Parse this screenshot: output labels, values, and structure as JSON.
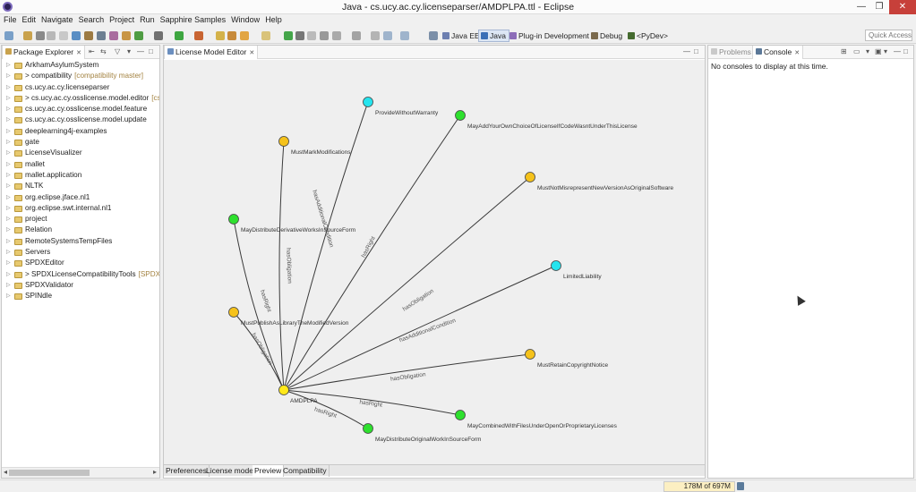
{
  "window": {
    "title": "Java - cs.ucy.ac.cy.licenseparser/AMDPLPA.ttl - Eclipse",
    "minimize": "—",
    "maximize": "❐",
    "close": "✕"
  },
  "menu": [
    "File",
    "Edit",
    "Navigate",
    "Search",
    "Project",
    "Run",
    "Sapphire Samples",
    "Window",
    "Help"
  ],
  "perspectives": [
    {
      "label": "Java EE",
      "color": "#6d7fb0",
      "active": false
    },
    {
      "label": "Java",
      "color": "#3b6fb6",
      "active": true
    },
    {
      "label": "Plug-in Development",
      "color": "#8d6db8",
      "active": false
    },
    {
      "label": "Debug",
      "color": "#7b6a4d",
      "active": false
    },
    {
      "label": "<PyDev>",
      "color": "#456b2f",
      "active": false
    }
  ],
  "quick_access": "Quick Access",
  "package_explorer": {
    "tab": "Package Explorer",
    "items": [
      {
        "label": "ArkhamAsylumSystem",
        "decoration": ""
      },
      {
        "label": "> compatibility",
        "decoration": "[compatibility master]"
      },
      {
        "label": "cs.ucy.ac.cy.licenseparser",
        "decoration": ""
      },
      {
        "label": "> cs.ucy.ac.cy.osslicense.model.editor",
        "decoration": "[cs.u"
      },
      {
        "label": "cs.ucy.ac.cy.osslicense.model.feature",
        "decoration": ""
      },
      {
        "label": "cs.ucy.ac.cy.osslicense.model.update",
        "decoration": ""
      },
      {
        "label": "deeplearning4j-examples",
        "decoration": ""
      },
      {
        "label": "gate",
        "decoration": ""
      },
      {
        "label": "LicenseVisualizer",
        "decoration": ""
      },
      {
        "label": "mallet",
        "decoration": ""
      },
      {
        "label": "mallet.application",
        "decoration": ""
      },
      {
        "label": "NLTK",
        "decoration": ""
      },
      {
        "label": "org.eclipse.jface.nl1",
        "decoration": ""
      },
      {
        "label": "org.eclipse.swt.internal.nl1",
        "decoration": ""
      },
      {
        "label": "project",
        "decoration": ""
      },
      {
        "label": "Relation",
        "decoration": ""
      },
      {
        "label": "RemoteSystemsTempFiles",
        "decoration": ""
      },
      {
        "label": "Servers",
        "decoration": ""
      },
      {
        "label": "SPDXEditor",
        "decoration": ""
      },
      {
        "label": "> SPDXLicenseCompatibilityTools",
        "decoration": "[SPDXLi"
      },
      {
        "label": "SPDXValidator",
        "decoration": ""
      },
      {
        "label": "SPINdle",
        "decoration": ""
      }
    ]
  },
  "editor": {
    "tab": "License Model Editor",
    "bottom_tabs": [
      "Preferences",
      "License model",
      "Preview",
      "Compatibility"
    ],
    "active_bottom_tab": "Preview"
  },
  "problems_tab": "Problems",
  "console": {
    "tab": "Console",
    "message": "No consoles to display at this time."
  },
  "status": {
    "heap": "178M of 697M"
  },
  "colors": {
    "right": "#2ee02e",
    "obligation": "#f5c21b",
    "condition": "#25e4ee",
    "center": "#ffe81a",
    "edge": "#3a3a3a"
  },
  "chart_data": {
    "type": "graph",
    "center": {
      "id": "AMDPLPA",
      "label": "AMDPLPA",
      "kind": "center"
    },
    "nodes": [
      {
        "id": "ProvideWithoutWarranty",
        "kind": "condition",
        "edge_label": ""
      },
      {
        "id": "MayAddYourOwnChoiceOfLicenseIfCodeWasntUnderThisLicense",
        "kind": "right",
        "edge_label": ""
      },
      {
        "id": "MustMarkModifications",
        "kind": "obligation",
        "edge_label": "hasObligation"
      },
      {
        "id": "MustNotMisrepresentNewVersionAsOriginalSoftware",
        "kind": "obligation",
        "edge_label": "hasObligation"
      },
      {
        "id": "MayDistributeDerivativeWorksInSourceForm",
        "kind": "right",
        "edge_label": "hasRight"
      },
      {
        "id": "LimitedLiability",
        "kind": "condition",
        "edge_label": "hasAdditionalCondition"
      },
      {
        "id": "MustPublishAsLibraryTheModifiedVersion",
        "kind": "obligation",
        "edge_label": "hasObligation"
      },
      {
        "id": "MustRetainCopyrightNotice",
        "kind": "obligation",
        "edge_label": "hasObligation"
      },
      {
        "id": "MayCombinedWithFilesUnderOpenOrProprietaryLicenses",
        "kind": "right",
        "edge_label": "hasRight"
      },
      {
        "id": "MayDistributeOriginalWorkInSourceForm",
        "kind": "right",
        "edge_label": "hasRight"
      }
    ],
    "extra_edge_labels": [
      "hasAdditionalCondition",
      "hasRight"
    ]
  }
}
